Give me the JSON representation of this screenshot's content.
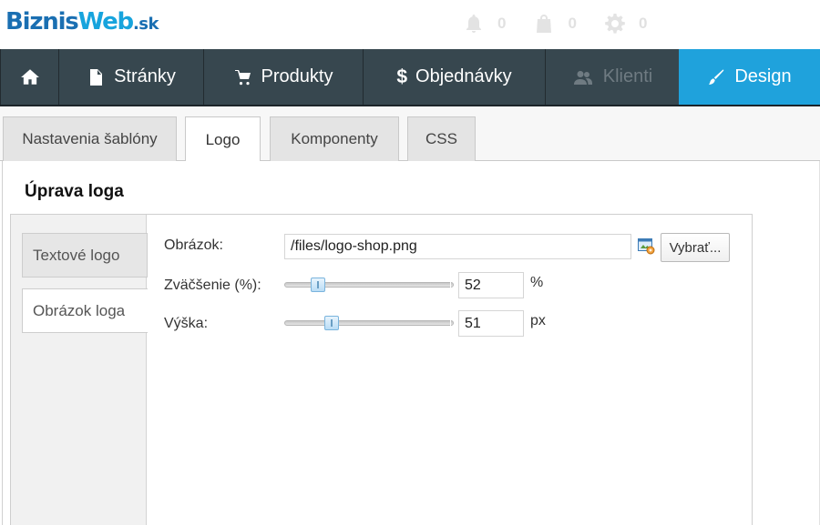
{
  "header": {
    "logo": {
      "part1": "Biznis",
      "part2": "Web",
      "part3": ".sk"
    },
    "counters": [
      {
        "icon": "bell-icon",
        "count": "0"
      },
      {
        "icon": "shopping-bag-icon",
        "count": "0"
      },
      {
        "icon": "gear-icon",
        "count": "0"
      }
    ]
  },
  "nav": {
    "home_icon": "home-icon",
    "items": [
      {
        "label": "Stránky",
        "icon": "page-icon"
      },
      {
        "label": "Produkty",
        "icon": "cart-icon"
      },
      {
        "label": "Objednávky",
        "icon": "dollar-icon",
        "glyph": "$"
      },
      {
        "label": "Klienti",
        "icon": "users-icon",
        "disabled": true
      },
      {
        "label": "Design",
        "icon": "brush-icon",
        "active": true
      }
    ]
  },
  "tabs": [
    {
      "label": "Nastavenia šablóny"
    },
    {
      "label": "Logo",
      "active": true
    },
    {
      "label": "Komponenty"
    },
    {
      "label": "CSS"
    }
  ],
  "section_title": "Úprava loga",
  "side_tabs": [
    {
      "label": "Textové logo"
    },
    {
      "label": "Obrázok loga",
      "active": true
    }
  ],
  "form": {
    "image_label": "Obrázok:",
    "image_value": "/files/logo-shop.png",
    "choose_button": "Vybrať...",
    "zoom_label": "Zväčšenie (%):",
    "zoom_value": "52",
    "zoom_unit": "%",
    "zoom_slider_fraction": 0.2,
    "height_label": "Výška:",
    "height_value": "51",
    "height_unit": "px",
    "height_slider_fraction": 0.28
  },
  "colors": {
    "nav_bg": "#37474f",
    "nav_active": "#1fa2dc",
    "logo_dark": "#1a6fb2",
    "logo_light": "#17a4dd"
  }
}
